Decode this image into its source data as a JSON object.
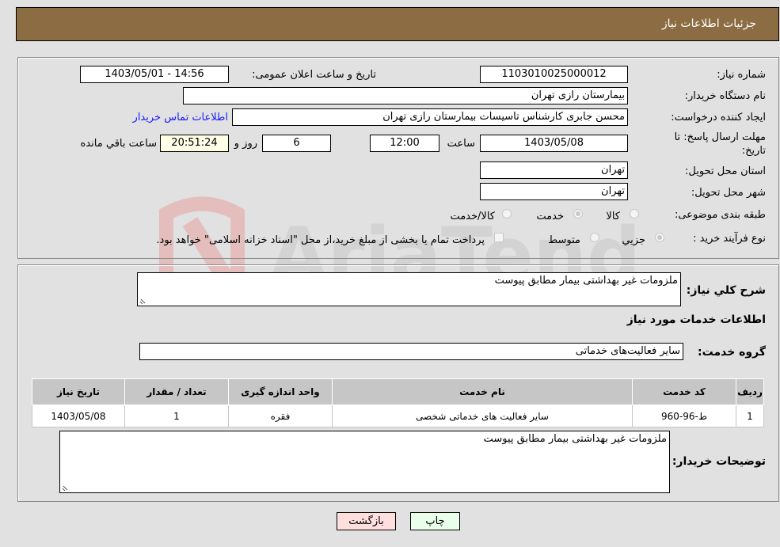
{
  "header": {
    "title": "جزئیات اطلاعات نیاز"
  },
  "form": {
    "need_number_label": "شماره نیاز:",
    "need_number": "1103010025000012",
    "announce_label": "تاریخ و ساعت اعلان عمومی:",
    "announce_value": "1403/05/01 - 14:56",
    "buyer_org_label": "نام دستگاه خریدار:",
    "buyer_org": "بیمارستان رازی تهران",
    "creator_label": "ایجاد کننده درخواست:",
    "creator": "محسن جابری کارشناس تاسیسات بیمارستان رازی تهران",
    "buyer_contact_link": "اطلاعات تماس خریدار",
    "deadline_label_line1": "مهلت ارسال پاسخ: تا",
    "deadline_label_line2": "تاریخ:",
    "deadline_date": "1403/05/08",
    "time_label": "ساعت",
    "deadline_time": "12:00",
    "days_value": "6",
    "days_label": "روز و",
    "remaining_time": "20:51:24",
    "remaining_label": "ساعت باقي مانده",
    "province_label": "استان محل تحویل:",
    "province": "تهران",
    "city_label": "شهر محل تحویل:",
    "city": "تهران",
    "category_label": "طبقه بندی موضوعی:",
    "category_options": [
      {
        "label": "کالا",
        "selected": false
      },
      {
        "label": "خدمت",
        "selected": true
      },
      {
        "label": "کالا/خدمت",
        "selected": false
      }
    ],
    "purchase_type_label": "نوع فرآیند خرید :",
    "purchase_type_options": [
      {
        "label": "جزيي",
        "selected": true
      },
      {
        "label": "متوسط",
        "selected": false
      }
    ],
    "treasury_checkbox_label": "پرداخت تمام یا بخشی از مبلغ خرید،از محل \"اسناد خزانه اسلامی\" خواهد بود.",
    "treasury_checked": false
  },
  "details": {
    "description_label": "شرح کلي نیاز:",
    "description": "ملزومات غیر بهداشتی بیمار مطابق پیوست",
    "services_heading": "اطلاعات خدمات مورد نیاز",
    "service_group_label": "گروه خدمت:",
    "service_group": "سایر فعالیت‌های خدماتی",
    "table": {
      "headers": [
        "ردیف",
        "کد خدمت",
        "نام خدمت",
        "واحد اندازه گیری",
        "تعداد / مقدار",
        "تاریخ نیاز"
      ],
      "rows": [
        [
          "1",
          "ط-96-960",
          "سایر فعالیت های خدماتی شخصی",
          "فقره",
          "1",
          "1403/05/08"
        ]
      ]
    },
    "buyer_notes_label": "توضیحات خریدار:",
    "buyer_notes": "ملزومات غیر بهداشتی بیمار مطابق پیوست"
  },
  "buttons": {
    "print": "چاپ",
    "back": "بازگشت"
  },
  "colors": {
    "header_bg": "#8c6c42",
    "print_bg": "#eaffea",
    "back_bg": "#ffdede",
    "link": "#1a1aff"
  }
}
